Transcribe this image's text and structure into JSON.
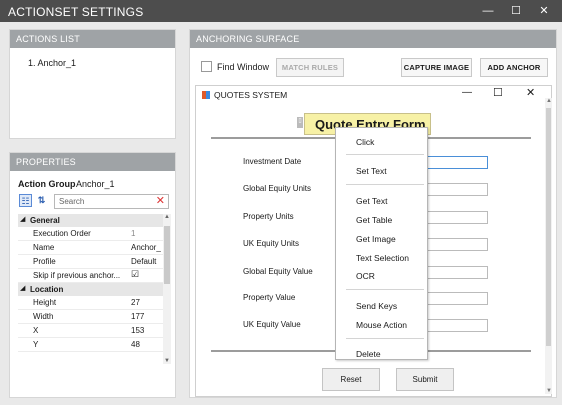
{
  "window": {
    "title": "ACTIONSET SETTINGS",
    "min_glyph": "—",
    "max_glyph": "☐",
    "close_glyph": "✕"
  },
  "actions_list": {
    "header": "ACTIONS LIST",
    "items": [
      "1. Anchor_1"
    ]
  },
  "properties": {
    "header": "PROPERTIES",
    "action_group_label": "Action Group",
    "action_group_value": "Anchor_1",
    "search_placeholder": "Search",
    "categories": [
      {
        "name": "General",
        "rows": [
          {
            "k": "Execution Order",
            "v": "1"
          },
          {
            "k": "Name",
            "v": "Anchor_"
          },
          {
            "k": "Profile",
            "v": "Default"
          },
          {
            "k": "Skip if previous anchor...",
            "v": "☑"
          }
        ]
      },
      {
        "name": "Location",
        "rows": [
          {
            "k": "Height",
            "v": "27"
          },
          {
            "k": "Width",
            "v": "177"
          },
          {
            "k": "X",
            "v": "153"
          },
          {
            "k": "Y",
            "v": "48"
          }
        ]
      }
    ]
  },
  "surface": {
    "header": "ANCHORING SURFACE",
    "find_window": "Find Window",
    "match_rules": "MATCH RULES",
    "capture_image": "CAPTURE IMAGE",
    "add_anchor": "ADD ANCHOR"
  },
  "quotes": {
    "title": "QUOTES SYSTEM",
    "heading": "Quote Entry Form",
    "fields": [
      "Investment Date",
      "Global Equity Units",
      "Property Units",
      "UK Equity Units",
      "Global Equity Value",
      "Property Value",
      "UK Equity Value"
    ],
    "reset": "Reset",
    "submit": "Submit"
  },
  "context_menu": [
    "Click",
    "Set Text",
    "Get Text",
    "Get Table",
    "Get Image",
    "Text Selection",
    "OCR",
    "Send Keys",
    "Mouse Action",
    "Delete"
  ]
}
